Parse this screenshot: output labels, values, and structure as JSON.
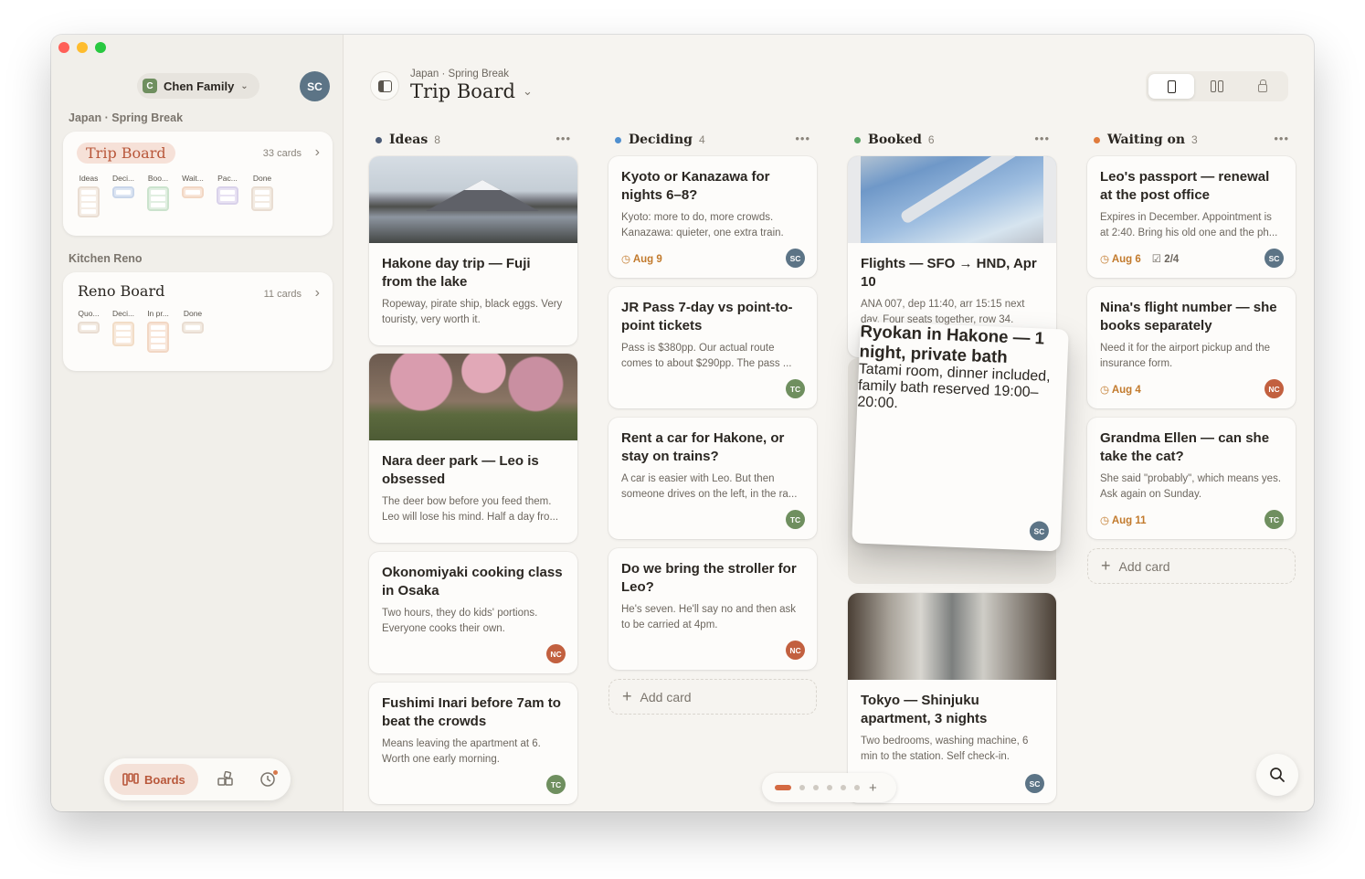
{
  "sidebar": {
    "family": {
      "label": "Chen Family",
      "initial": "C"
    },
    "user_avatar": "SC",
    "sections": [
      {
        "title": "Japan · Spring Break",
        "board": {
          "title": "Trip Board",
          "count": "33 cards",
          "columns": [
            "Ideas",
            "Deci...",
            "Boo...",
            "Wait...",
            "Pac...",
            "Done"
          ]
        }
      },
      {
        "title": "Kitchen Reno",
        "board": {
          "title": "Reno Board",
          "count": "11 cards",
          "columns": [
            "Quo...",
            "Deci...",
            "In pr...",
            "Done"
          ]
        }
      }
    ],
    "dock": {
      "boards_label": "Boards"
    }
  },
  "header": {
    "breadcrumb": "Japan · Spring Break",
    "title": "Trip Board"
  },
  "columns": [
    {
      "name": "Ideas",
      "count": "8",
      "color": "#4a5a75",
      "cards": [
        {
          "title": "Hakone day trip — Fuji from the lake",
          "desc": "Ropeway, pirate ship, black eggs. Very touristy, very worth it."
        },
        {
          "title": "Nara deer park — Leo is obsessed",
          "desc": "The deer bow before you feed them. Leo will lose his mind. Half a day fro..."
        },
        {
          "title": "Okonomiyaki cooking class in Osaka",
          "desc": "Two hours, they do kids' portions. Everyone cooks their own.",
          "avatar": "NC"
        },
        {
          "title": "Fushimi Inari before 7am to beat the crowds",
          "desc": "Means leaving the apartment at 6. Worth one early morning.",
          "avatar": "TC"
        }
      ]
    },
    {
      "name": "Deciding",
      "count": "4",
      "color": "#4f8fcf",
      "cards": [
        {
          "title": "Kyoto or Kanazawa for nights 6–8?",
          "desc": "Kyoto: more to do, more crowds. Kanazawa: quieter, one extra train.",
          "date": "Aug 9",
          "avatar": "SC"
        },
        {
          "title": "JR Pass 7-day vs point-to-point tickets",
          "desc": "Pass is $380pp. Our actual route comes to about $290pp. The pass ...",
          "avatar": "TC"
        },
        {
          "title": "Rent a car for Hakone, or stay on trains?",
          "desc": "A car is easier with Leo. But then someone drives on the left, in the ra...",
          "avatar": "TC"
        },
        {
          "title": "Do we bring the stroller for Leo?",
          "desc": "He's seven. He'll say no and then ask to be carried at 4pm.",
          "avatar": "NC"
        }
      ],
      "add_label": "Add card"
    },
    {
      "name": "Booked",
      "count": "6",
      "color": "#5aa564",
      "cards": [
        {
          "title": "Flights — SFO → HND, Apr 10",
          "desc": "ANA 007, dep 11:40, arr 15:15 next day. Four seats together, row 34."
        },
        {
          "title": "Tokyo — Shinjuku apartment, 3 nights",
          "desc": "Two bedrooms, washing machine, 6 min to the station. Self check-in.",
          "avatar": "SC"
        }
      ],
      "dragging": {
        "title": "Ryokan in Hakone — 1 night, private bath",
        "desc": "Tatami room, dinner included, family bath reserved 19:00–20:00.",
        "avatar": "SC"
      }
    },
    {
      "name": "Waiting on",
      "count": "3",
      "color": "#e07b3c",
      "cards": [
        {
          "title": "Leo's passport — renewal at the post office",
          "desc": "Expires in December. Appointment is at 2:40. Bring his old one and the ph...",
          "date": "Aug 6",
          "checklist": "2/4",
          "avatar": "SC"
        },
        {
          "title": "Nina's flight number — she books separately",
          "desc": "Need it for the airport pickup and the insurance form.",
          "date": "Aug 4",
          "avatar": "NC"
        },
        {
          "title": "Grandma Ellen — can she take the cat?",
          "desc": "She said \"probably\", which means yes. Ask again on Sunday.",
          "date": "Aug 11",
          "avatar": "TC"
        }
      ],
      "add_label": "Add card"
    }
  ],
  "avatar_colors": {
    "SC": "#5c7486",
    "TC": "#6f8f5f",
    "NC": "#c2603f"
  },
  "pager": {
    "pages": 6,
    "active": 1
  }
}
